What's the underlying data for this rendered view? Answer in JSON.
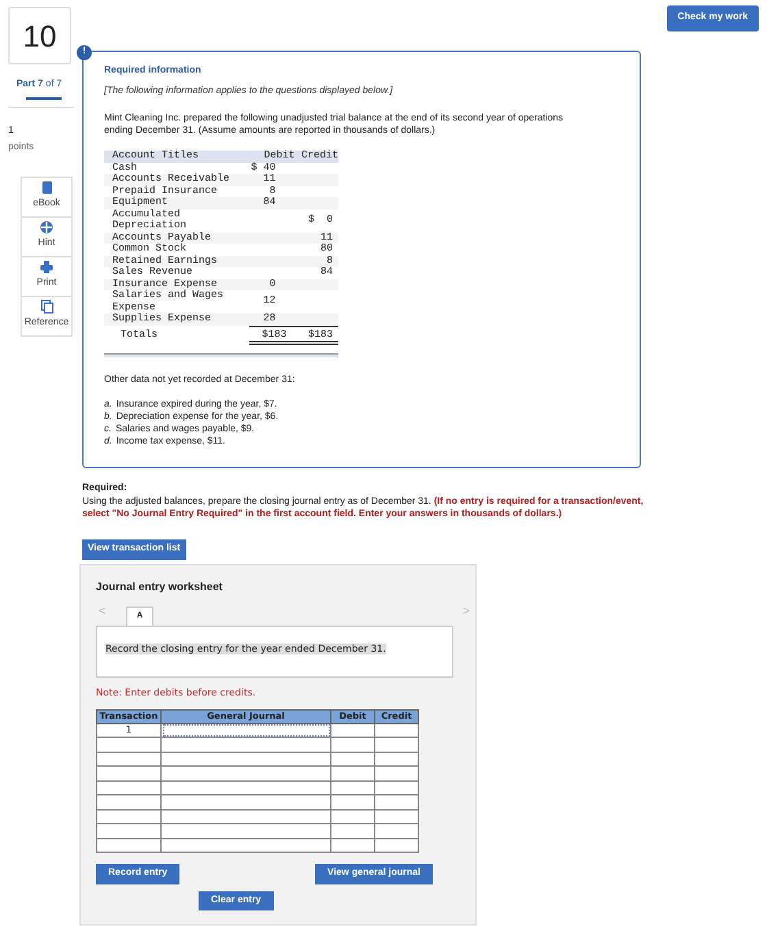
{
  "header": {
    "check_button": "Check my work"
  },
  "question": {
    "number": "10",
    "part": "Part 7",
    "part_total": "of 7",
    "points_value": "1",
    "points_label": "points"
  },
  "tools": [
    {
      "label": "eBook",
      "kind": "book"
    },
    {
      "label": "Hint",
      "kind": "hint"
    },
    {
      "label": "Print",
      "kind": "print"
    },
    {
      "label": "Reference",
      "kind": "reference"
    }
  ],
  "info": {
    "badge": "!",
    "title": "Required information",
    "note": "[The following information applies to the questions displayed below.]",
    "intro": "Mint Cleaning Inc. prepared the following unadjusted trial balance at the end of its second year of operations ending December 31. (Assume amounts are reported in thousands of dollars.)",
    "trial_balance": {
      "columns": [
        "Account Titles",
        "Debit",
        "Credit"
      ],
      "rows": [
        [
          "Cash",
          "$ 40",
          ""
        ],
        [
          "Accounts Receivable",
          "11",
          ""
        ],
        [
          "Prepaid Insurance",
          "8",
          ""
        ],
        [
          "Equipment",
          "84",
          ""
        ],
        [
          "Accumulated Depreciation",
          "",
          "$  0"
        ],
        [
          "Accounts Payable",
          "",
          "11"
        ],
        [
          "Common Stock",
          "",
          "80"
        ],
        [
          "Retained Earnings",
          "",
          "8"
        ],
        [
          "Sales Revenue",
          "",
          "84"
        ],
        [
          "Insurance Expense",
          "0",
          ""
        ],
        [
          "Salaries and Wages Expense",
          "12",
          ""
        ],
        [
          "Supplies Expense",
          "28",
          ""
        ]
      ],
      "totals": [
        "Totals",
        "$183",
        "$183"
      ]
    },
    "other_title": "Other data not yet recorded at December 31:",
    "other_items": [
      {
        "marker": "a.",
        "text": "Insurance expired during the year, $7."
      },
      {
        "marker": "b.",
        "text": "Depreciation expense for the year, $6."
      },
      {
        "marker": "c.",
        "text": "Salaries and wages payable, $9."
      },
      {
        "marker": "d.",
        "text": "Income tax expense, $11."
      }
    ]
  },
  "required": {
    "label": "Required:",
    "text": "Using the adjusted balances, prepare the closing journal entry as of December 31. ",
    "instruction": "(If no entry is required for a transaction/event, select \"No Journal Entry Required\" in the first account field. Enter your answers in thousands of dollars.)"
  },
  "view_list_button": "View transaction list",
  "worksheet": {
    "title": "Journal entry worksheet",
    "prev": "<",
    "next": ">",
    "tabs": [
      {
        "label": "A",
        "selected": true
      }
    ],
    "description": "Record the closing entry for the year ended December 31.",
    "note": "Note: Enter debits before credits.",
    "columns": [
      "Transaction",
      "General Journal",
      "Debit",
      "Credit"
    ],
    "rows": [
      [
        "1",
        "",
        "",
        ""
      ],
      [
        "",
        "",
        "",
        ""
      ],
      [
        "",
        "",
        "",
        ""
      ],
      [
        "",
        "",
        "",
        ""
      ],
      [
        "",
        "",
        "",
        ""
      ],
      [
        "",
        "",
        "",
        ""
      ],
      [
        "",
        "",
        "",
        ""
      ],
      [
        "",
        "",
        "",
        ""
      ],
      [
        "",
        "",
        "",
        ""
      ]
    ],
    "buttons": {
      "record": "Record entry",
      "view_journal": "View general journal",
      "clear": "Clear entry"
    }
  }
}
